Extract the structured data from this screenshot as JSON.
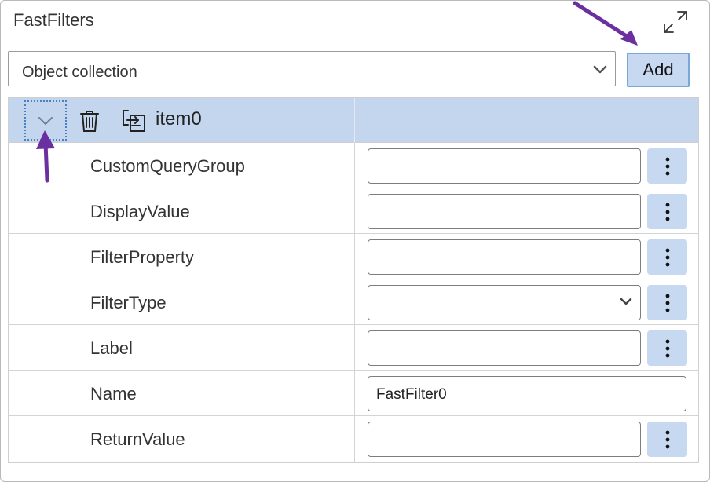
{
  "panel": {
    "title": "FastFilters",
    "expand_icon": "expand-icon"
  },
  "collection": {
    "selected": "Object collection",
    "add_label": "Add"
  },
  "item": {
    "label": "item0",
    "icons": [
      "chevron-down-icon",
      "trash-icon",
      "move-icon"
    ]
  },
  "properties": [
    {
      "label": "CustomQueryGroup",
      "value": "",
      "type": "text",
      "has_more": true
    },
    {
      "label": "DisplayValue",
      "value": "",
      "type": "text",
      "has_more": true
    },
    {
      "label": "FilterProperty",
      "value": "",
      "type": "text",
      "has_more": true
    },
    {
      "label": "FilterType",
      "value": "",
      "type": "dropdown",
      "has_more": true
    },
    {
      "label": "Label",
      "value": "",
      "type": "text",
      "has_more": true
    },
    {
      "label": "Name",
      "value": "FastFilter0",
      "type": "text",
      "has_more": false
    },
    {
      "label": "ReturnValue",
      "value": "",
      "type": "text",
      "has_more": true
    }
  ],
  "colors": {
    "header_bg": "#c4d6ee",
    "button_bg": "#c7d9f0",
    "annotation_arrow": "#6b2fa0"
  }
}
